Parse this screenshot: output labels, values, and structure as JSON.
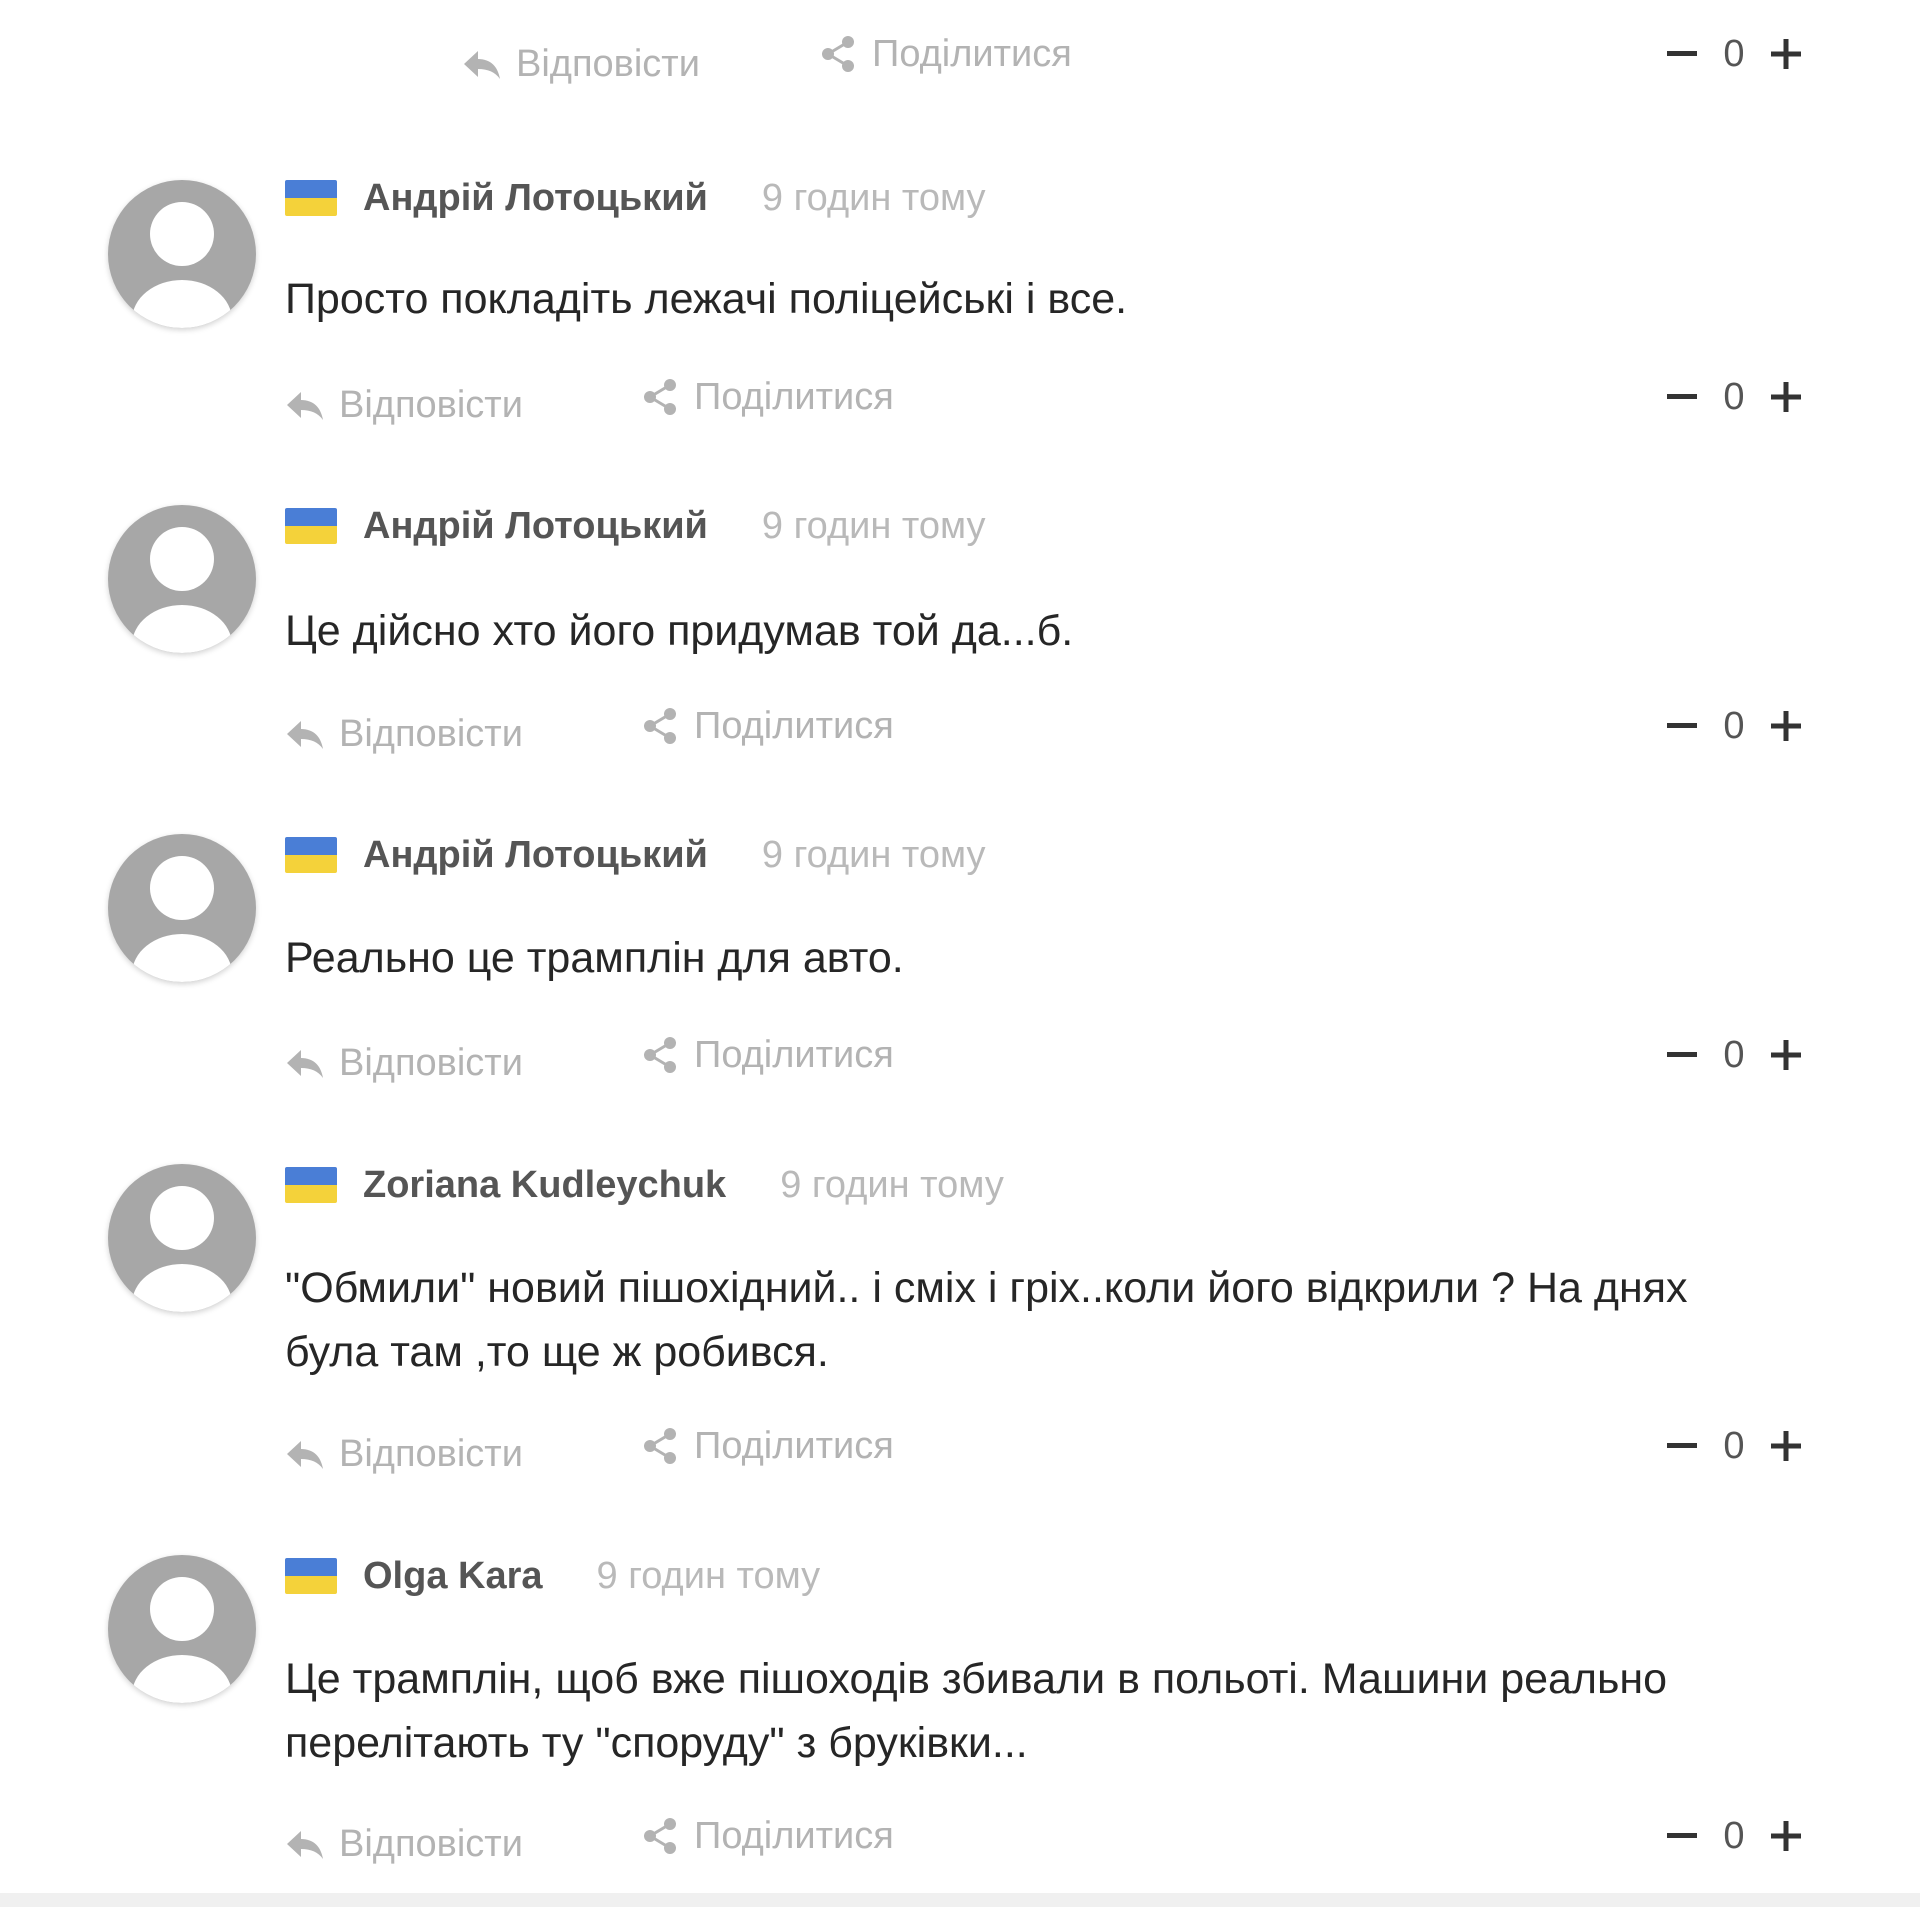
{
  "actions": {
    "reply_label": "Відповісти",
    "share_label": "Поділитися",
    "minus_label": "−",
    "plus_label": "+"
  },
  "top_bar": {
    "score": "0"
  },
  "comments": [
    {
      "author": "Андрій Лотоцький",
      "time": "9 годин тому",
      "text": "Просто покладіть лежачі поліцейські і все.",
      "score": "0"
    },
    {
      "author": "Андрій Лотоцький",
      "time": "9 годин тому",
      "text": "Це дійсно хто його придумав той да...б.",
      "score": "0"
    },
    {
      "author": "Андрій Лотоцький",
      "time": "9 годин тому",
      "text": "Реально це трамплін для авто.",
      "score": "0"
    },
    {
      "author": "Zoriana Kudleychuk",
      "time": "9 годин тому",
      "text": "\"Обмили\" новий пішохідний.. і сміх і гріх..коли його відкрили ? На днях була там ,то ще ж робився.",
      "score": "0"
    },
    {
      "author": "Olga Kara",
      "time": "9 годин тому",
      "text": "Це трамплін, щоб вже пішоходів збивали в польоті. Машини реально перелітають ту \"споруду\" з бруківки...",
      "score": "0"
    }
  ],
  "colors": {
    "flag_blue": "#4a7ed6",
    "flag_yellow": "#f4d23a",
    "muted_text": "#b3b3b3",
    "avatar_bg": "#a7a7a7"
  },
  "icons": {
    "reply": "reply-arrow-icon",
    "share": "share-icon",
    "minus": "minus-icon",
    "plus": "plus-icon",
    "avatar": "user-avatar-icon",
    "flag": "ukraine-flag-icon"
  }
}
